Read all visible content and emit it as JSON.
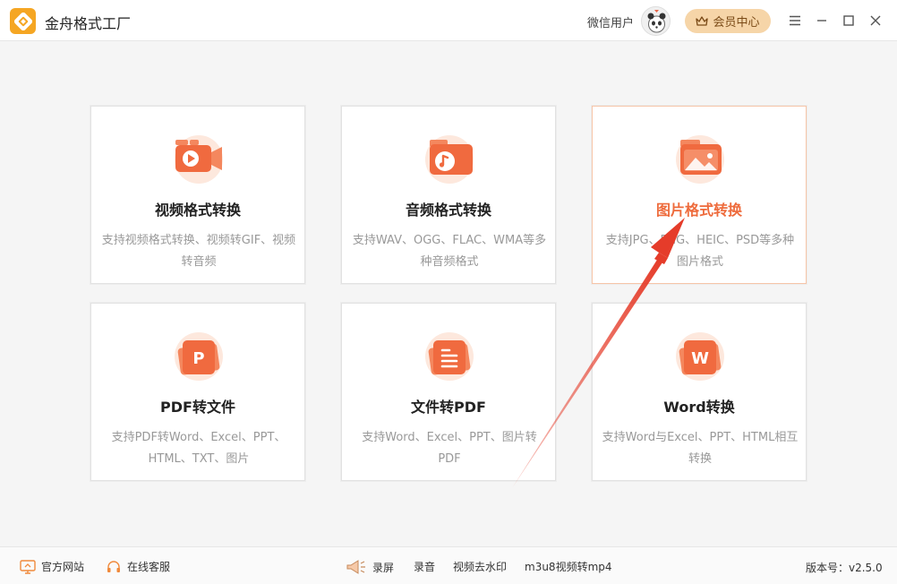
{
  "app": {
    "title": "金舟格式工厂",
    "user_name": "微信用户",
    "vip_label": "会员中心"
  },
  "cards": [
    {
      "title": "视频格式转换",
      "desc": "支持视频格式转换、视频转GIF、视频转音频",
      "icon": "video-icon"
    },
    {
      "title": "音频格式转换",
      "desc": "支持WAV、OGG、FLAC、WMA等多种音频格式",
      "icon": "music-icon"
    },
    {
      "title": "图片格式转换",
      "desc": "支持JPG、PNG、HEIC、PSD等多种图片格式",
      "icon": "image-icon"
    },
    {
      "title": "PDF转文件",
      "desc": "支持PDF转Word、Excel、PPT、HTML、TXT、图片",
      "icon": "pdf-icon",
      "glyph": "P"
    },
    {
      "title": "文件转PDF",
      "desc": "支持Word、Excel、PPT、图片转PDF",
      "icon": "document-icon"
    },
    {
      "title": "Word转换",
      "desc": "支持Word与Excel、PPT、HTML相互转换",
      "icon": "word-icon",
      "glyph": "W"
    }
  ],
  "footer": {
    "website": "官方网站",
    "service": "在线客服",
    "record_screen": "录屏",
    "record_audio": "录音",
    "remove_watermark": "视频去水印",
    "m3u8": "m3u8视频转mp4",
    "version": "版本号：v2.5.0"
  },
  "colors": {
    "accent": "#ee6b3c",
    "vip_bg": "#f6d5a8",
    "annotation_arrow": "#e53c2a"
  }
}
